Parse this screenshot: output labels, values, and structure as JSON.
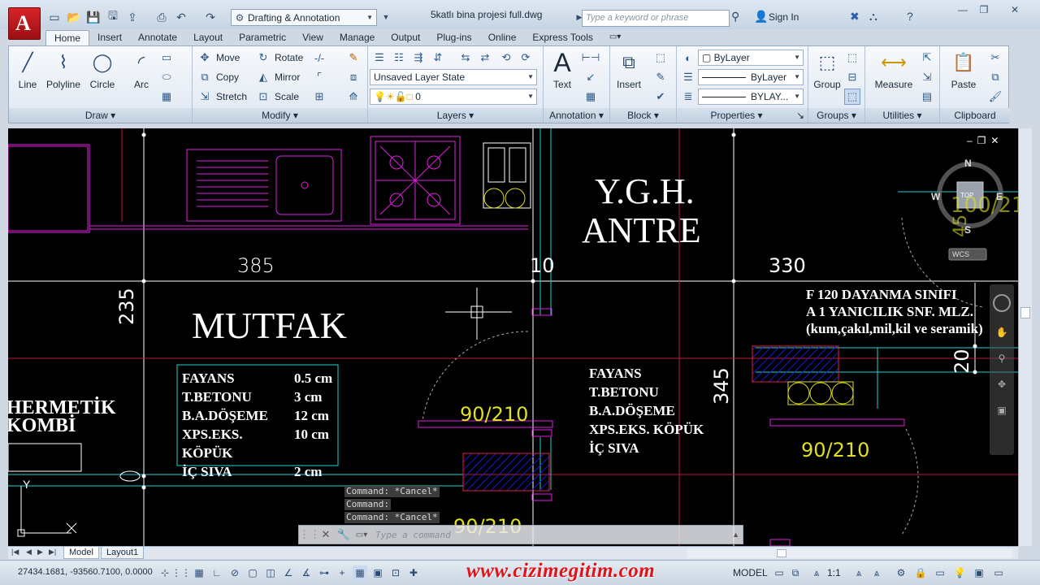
{
  "app": {
    "logo_letter": "A",
    "workspace": "Drafting & Annotation",
    "document_title": "5katlı bina projesi full.dwg",
    "search_placeholder": "Type a keyword or phrase",
    "sign_in": "Sign In",
    "accent_color": "#c8161d"
  },
  "ribbon_tabs": [
    "Home",
    "Insert",
    "Annotate",
    "Layout",
    "Parametric",
    "View",
    "Manage",
    "Output",
    "Plug-ins",
    "Online",
    "Express Tools"
  ],
  "active_tab": "Home",
  "panels": {
    "draw": {
      "title": "Draw",
      "tools": [
        "Line",
        "Polyline",
        "Circle",
        "Arc"
      ]
    },
    "modify": {
      "title": "Modify",
      "tools": [
        "Move",
        "Rotate",
        "Copy",
        "Mirror",
        "Stretch",
        "Scale"
      ]
    },
    "layers": {
      "title": "Layers",
      "layer_state": "Unsaved Layer State",
      "current_layer": "0"
    },
    "annotation": {
      "title": "Annotation",
      "tool": "Text"
    },
    "block": {
      "title": "Block",
      "tool": "Insert"
    },
    "properties": {
      "title": "Properties",
      "color": "ByLayer",
      "linetype": "ByLayer",
      "lineweight": "BYLAY..."
    },
    "groups": {
      "title": "Groups",
      "tool": "Group"
    },
    "utilities": {
      "title": "Utilities",
      "tool": "Measure"
    },
    "clipboard": {
      "title": "Clipboard",
      "tool": "Paste"
    }
  },
  "drawing": {
    "room_1": "Y.G.H.",
    "room_2": "ANTRE",
    "room_3": "MUTFAK",
    "label_hermetik_1": "HERMETİK",
    "label_hermetik_2": "KOMBİ",
    "dim_385": "385",
    "dim_10": "10",
    "dim_330": "330",
    "dim_235": "235",
    "dim_345": "345",
    "dim_20": "20",
    "door_1": "90/210",
    "door_2": "90/210",
    "door_3": "90/210",
    "fire_1": "F 120 DAYANMA SINIFI",
    "fire_2": "A 1 YANICILIK SNF. MLZ.",
    "fire_3": "(kum,çakıl,mil,kil ve seramik)",
    "materials": [
      {
        "name": "FAYANS",
        "value": "0.5 cm"
      },
      {
        "name": "T.BETONU",
        "value": "3 cm"
      },
      {
        "name": "B.A.DÖŞEME",
        "value": "12 cm"
      },
      {
        "name": "XPS.EKS. KÖPÜK",
        "value": "10 cm"
      },
      {
        "name": "İÇ SIVA",
        "value": "2 cm"
      }
    ],
    "materials_2": [
      "FAYANS",
      "T.BETONU",
      "B.A.DÖŞEME",
      "XPS.EKS. KÖPÜK",
      "İÇ SIVA"
    ],
    "viewcube": {
      "n": "N",
      "s": "S",
      "w": "W",
      "e": "E",
      "top": "TOP",
      "wcs": "WCS"
    },
    "top_right_partial": "100/21",
    "top_right_partial_2": "45",
    "ucs_y": "Y"
  },
  "command": {
    "history": [
      "Command: *Cancel*",
      "Command:",
      "Command: *Cancel*"
    ],
    "placeholder": "Type a command"
  },
  "layout_tabs": [
    "Model",
    "Layout1"
  ],
  "status": {
    "coordinates": "27434.1681, -93560.7100, 0.0000",
    "watermark": "www.cizimegitim.com",
    "model": "MODEL",
    "scale": "1:1"
  }
}
